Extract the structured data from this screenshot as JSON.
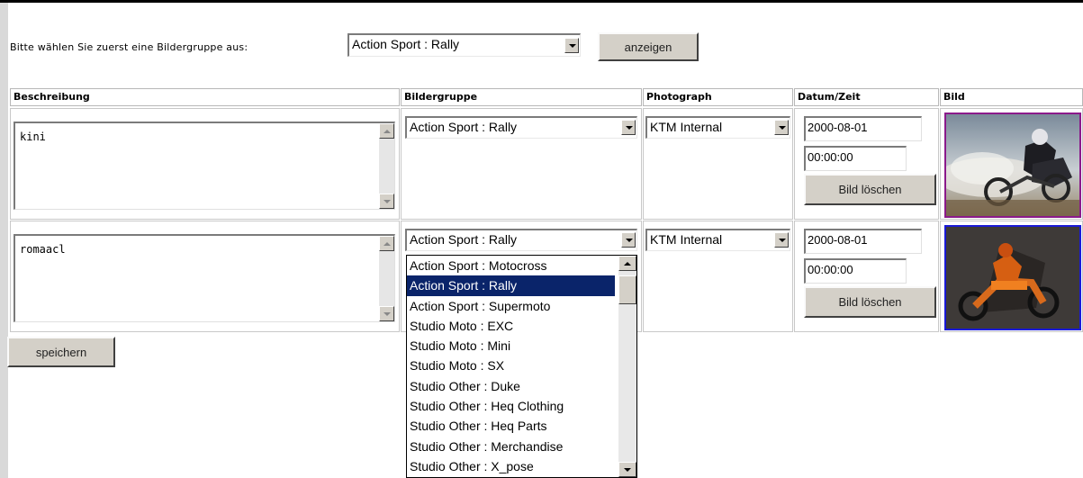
{
  "filter": {
    "label": "Bitte wählen Sie zuerst eine Bildergruppe aus:",
    "selected": "Action Sport : Rally",
    "show_button": "anzeigen"
  },
  "table": {
    "headers": [
      "Beschreibung",
      "Bildergruppe",
      "Photograph",
      "Datum/Zeit",
      "Bild"
    ],
    "rows": [
      {
        "description": "kini",
        "group": "Action Sport : Rally",
        "photographer": "KTM Internal",
        "date": "2000-08-01",
        "time": "00:00:00",
        "delete_button": "Bild löschen",
        "image_icon": "rally-rider-photo-icon",
        "image_border": "#8b1a8b"
      },
      {
        "description": "romaacl",
        "group": "Action Sport : Rally",
        "photographer": "KTM Internal",
        "date": "2000-08-01",
        "time": "00:00:00",
        "delete_button": "Bild löschen",
        "image_icon": "motocross-rider-photo-icon",
        "image_border": "#1a1ad6"
      }
    ]
  },
  "save_button": "speichern",
  "dropdown_open": {
    "options": [
      "Action Sport : Motocross",
      "Action Sport : Rally",
      "Action Sport : Supermoto",
      "Studio Moto : EXC",
      "Studio Moto : Mini",
      "Studio Moto : SX",
      "Studio Other : Duke",
      "Studio Other : Heq Clothing",
      "Studio Other : Heq Parts",
      "Studio Other : Merchandise",
      "Studio Other : X_pose"
    ],
    "highlighted": "Action Sport : Rally",
    "highlight_color": "#0a246a"
  }
}
